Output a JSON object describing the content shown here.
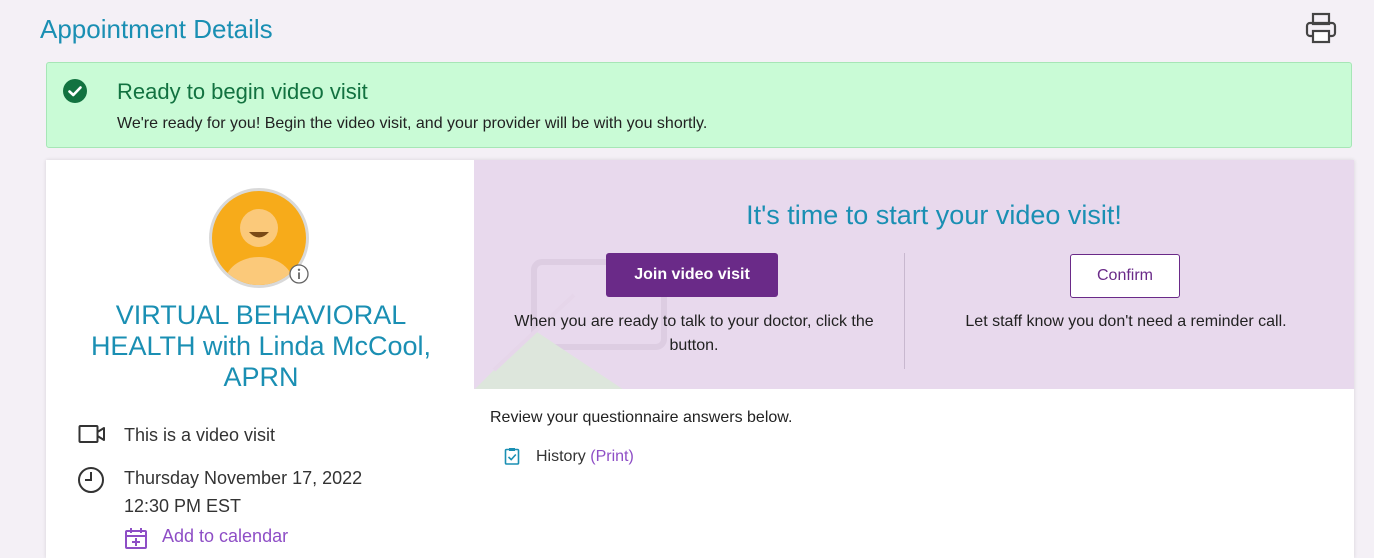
{
  "header": {
    "title": "Appointment Details",
    "print_icon": "printer-icon"
  },
  "alert": {
    "icon": "check-circle-icon",
    "title": "Ready to begin video visit",
    "message": "We're ready for you! Begin the video visit, and your provider will be with you shortly.",
    "color": "#127240",
    "background": "#c9fbd6"
  },
  "provider": {
    "name": "VIRTUAL BEHAVIORAL HEALTH with Linda McCool, APRN",
    "avatar_icon": "person-avatar-icon",
    "info_icon": "info-icon"
  },
  "visit": {
    "type_icon": "video-camera-icon",
    "type_text": "This is a video visit",
    "time_icon": "clock-icon",
    "date": "Thursday November 17, 2022",
    "time": "12:30 PM EST",
    "calendar_icon": "calendar-add-icon",
    "add_to_calendar": "Add to calendar"
  },
  "start": {
    "heading": "It's time to start your video visit!",
    "join_label": "Join video visit",
    "join_desc": "When you are ready to talk to your doctor, click the button.",
    "confirm_label": "Confirm",
    "confirm_desc": "Let staff know you don't need a reminder call.",
    "accent": "#6a2a88"
  },
  "questionnaire": {
    "intro": "Review your questionnaire answers below.",
    "icon": "clipboard-check-icon",
    "item_label": "History",
    "print_label": "(Print)"
  }
}
